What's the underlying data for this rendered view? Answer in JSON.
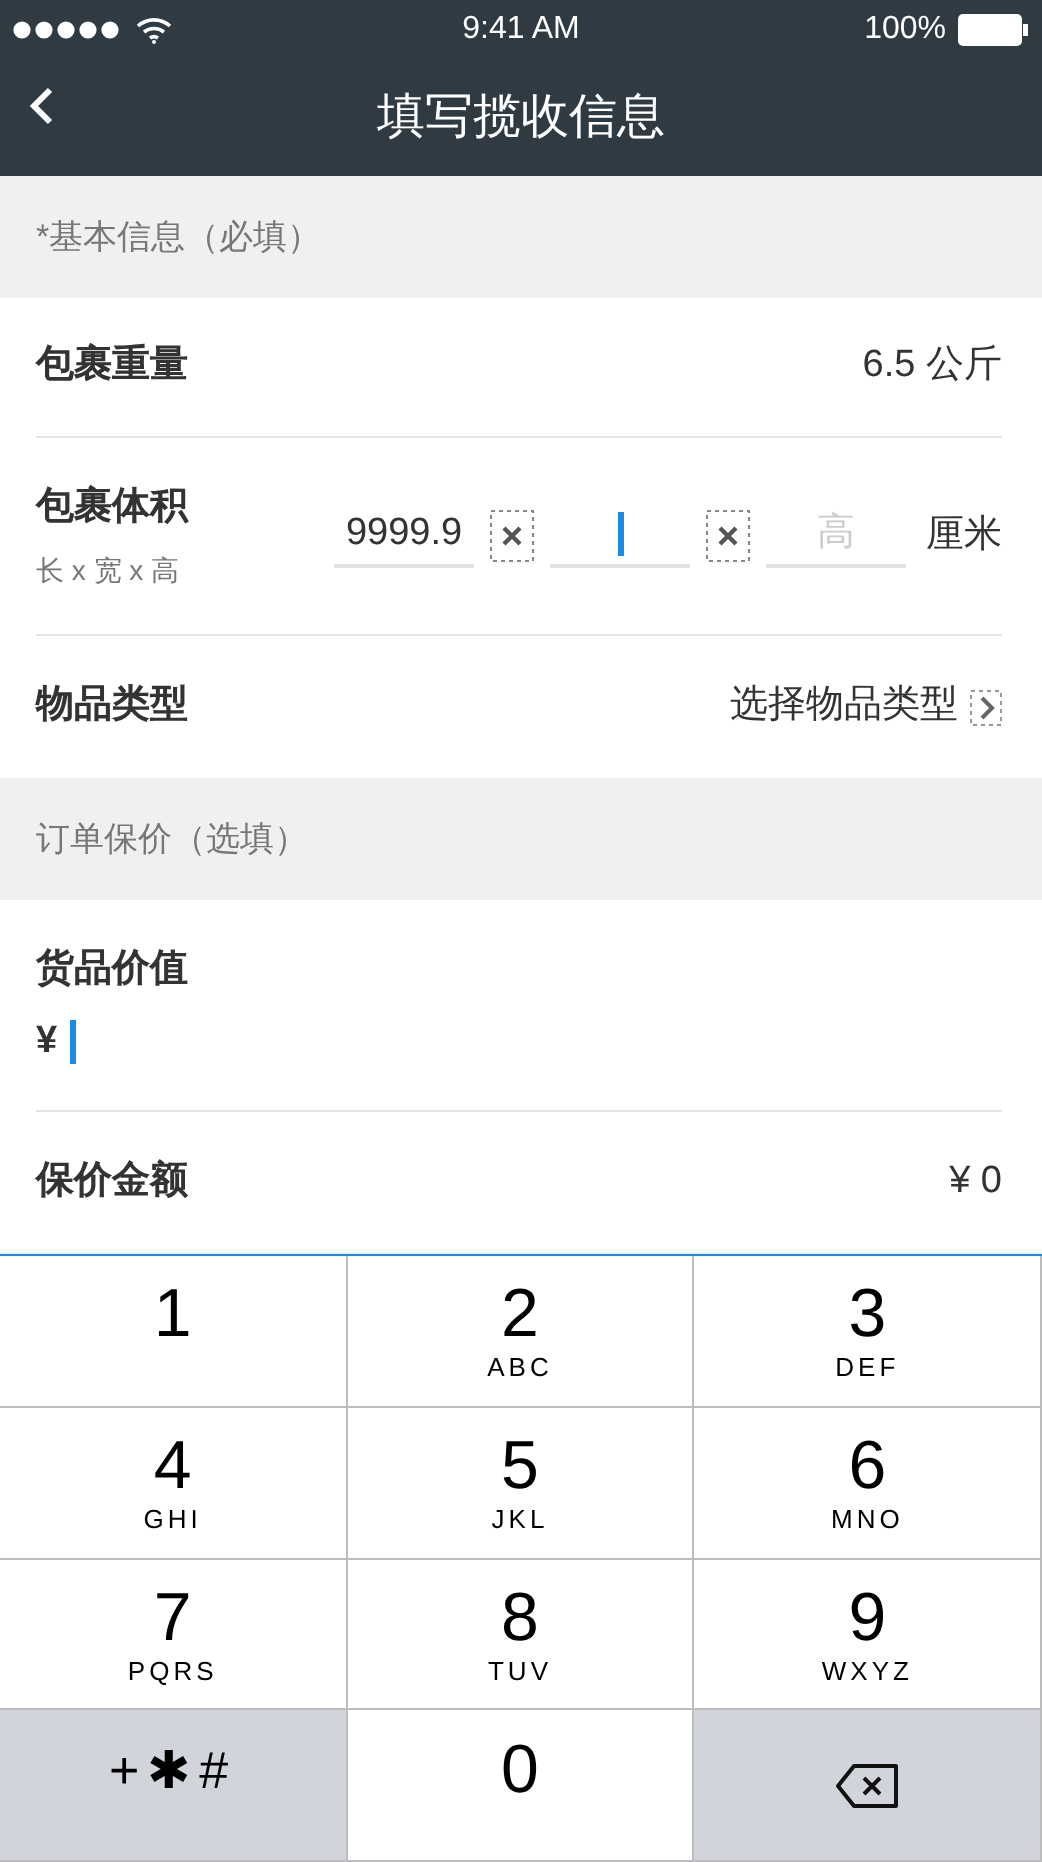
{
  "status_bar": {
    "time": "9:41 AM",
    "battery": "100%"
  },
  "nav": {
    "title": "填写揽收信息"
  },
  "sections": [
    {
      "header": "*基本信息（必填）",
      "rows": [
        {
          "kind": "value",
          "label": "包裹重量",
          "value": "6.5 公斤"
        },
        {
          "kind": "dimensions",
          "label": "包裹体积",
          "hint": "长 x 宽 x 高",
          "unit": "厘米",
          "fields": [
            {
              "value": "9999.9",
              "focused": false
            },
            {
              "focused": true
            },
            {
              "placeholder": "高",
              "focused": false
            }
          ]
        },
        {
          "kind": "picker",
          "label": "物品类型",
          "value": "选择物品类型"
        }
      ]
    },
    {
      "header": "订单保价（选填）",
      "rows": [
        {
          "kind": "money_input",
          "label": "货品价值",
          "prefix": "¥",
          "focused": true
        },
        {
          "kind": "value",
          "label": "保价金额",
          "value": "¥ 0"
        }
      ]
    }
  ],
  "keyboard": [
    {
      "kind": "digit",
      "label": "1"
    },
    {
      "kind": "digit",
      "label": "2",
      "letters": "ABC"
    },
    {
      "kind": "digit",
      "label": "3",
      "letters": "DEF"
    },
    {
      "kind": "digit",
      "label": "4",
      "letters": "GHI"
    },
    {
      "kind": "digit",
      "label": "5",
      "letters": "JKL"
    },
    {
      "kind": "digit",
      "label": "6",
      "letters": "MNO"
    },
    {
      "kind": "digit",
      "label": "7",
      "letters": "PQRS"
    },
    {
      "kind": "digit",
      "label": "8",
      "letters": "TUV"
    },
    {
      "kind": "digit",
      "label": "9",
      "letters": "WXYZ"
    },
    {
      "kind": "symbols",
      "label": "+✱#"
    },
    {
      "kind": "digit",
      "label": "0"
    },
    {
      "kind": "delete"
    }
  ]
}
